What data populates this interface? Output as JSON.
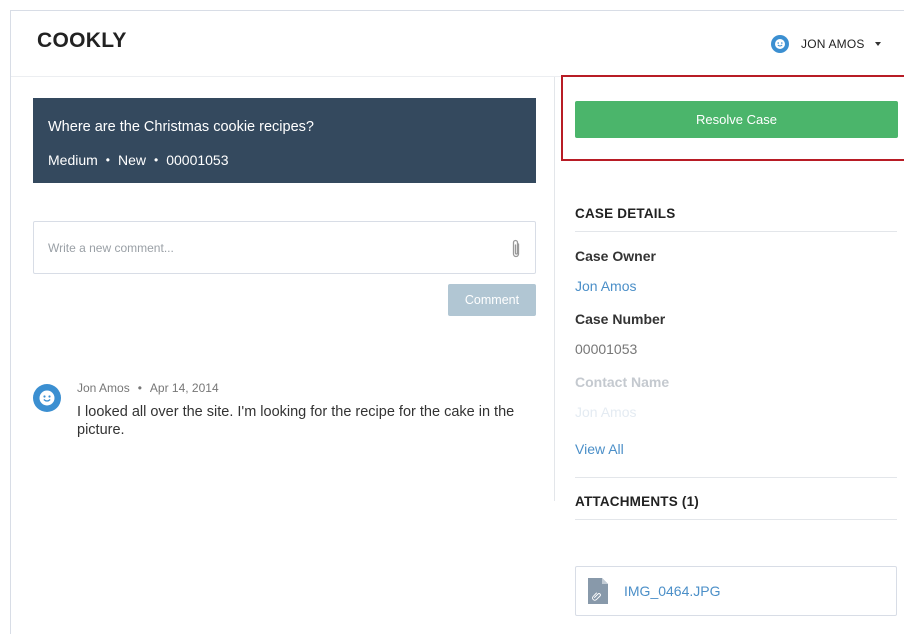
{
  "header": {
    "logo": "COOKLY",
    "user_name": "JON AMOS"
  },
  "case": {
    "title": "Where are the Christmas cookie recipes?",
    "priority": "Medium",
    "status": "New",
    "number": "00001053",
    "separator": "•"
  },
  "comment": {
    "placeholder": "Write a new comment...",
    "button_label": "Comment"
  },
  "feed": [
    {
      "author": "Jon Amos",
      "date": "Apr 14, 2014",
      "text": "I looked all over the site. I'm looking for the recipe for the cake in the picture."
    }
  ],
  "actions": {
    "resolve_label": "Resolve Case",
    "highlight_color": "#b81c25",
    "resolve_color": "#4bb56b"
  },
  "case_details": {
    "title": "CASE DETAILS",
    "fields": [
      {
        "label": "Case Owner",
        "value": "Jon Amos"
      },
      {
        "label": "Case Number",
        "value": "00001053"
      },
      {
        "label": "Contact Name",
        "value": "Jon Amos"
      }
    ],
    "view_all": "View All"
  },
  "attachments": {
    "title": "ATTACHMENTS (1)",
    "items": [
      {
        "name": "IMG_0464.JPG",
        "icon": "image-file-icon"
      }
    ]
  },
  "icons": {
    "user": "smiley-avatar-icon",
    "menu": "caret-down-icon",
    "attach": "paperclip-icon"
  },
  "colors": {
    "banner": "#34495e",
    "link": "#4b8fc8",
    "avatar": "#3b8fd1"
  }
}
